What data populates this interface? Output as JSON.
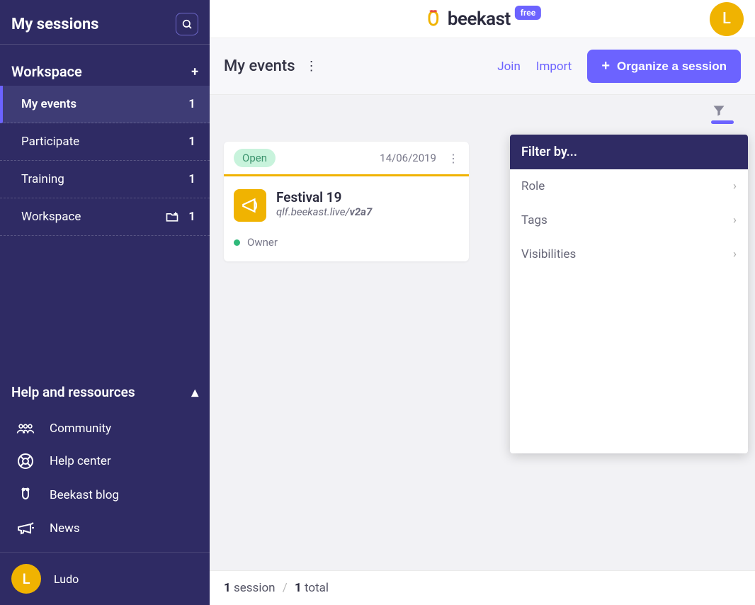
{
  "sidebar": {
    "title": "My sessions",
    "workspace_header": "Workspace",
    "items": [
      {
        "label": "My events",
        "count": "1",
        "active": true
      },
      {
        "label": "Participate",
        "count": "1"
      },
      {
        "label": "Training",
        "count": "1"
      },
      {
        "label": "Workspace",
        "count": "1",
        "icon": "folder-add"
      }
    ],
    "help_header": "Help and ressources",
    "help_items": [
      {
        "label": "Community",
        "icon": "people"
      },
      {
        "label": "Help center",
        "icon": "lifebuoy"
      },
      {
        "label": "Beekast blog",
        "icon": "bee"
      },
      {
        "label": "News",
        "icon": "megaphone"
      }
    ],
    "user": {
      "name": "Ludo",
      "initial": "L"
    }
  },
  "topbar": {
    "brand": "beekast",
    "badge": "free",
    "avatar_initial": "L"
  },
  "toolbar": {
    "title": "My events",
    "join": "Join",
    "import": "Import",
    "organize": "Organize a session"
  },
  "event": {
    "status": "Open",
    "date": "14/06/2019",
    "title": "Festival 19",
    "url_base": "qlf.beekast.live/",
    "url_slug": "v2a7",
    "role": "Owner"
  },
  "filter": {
    "header": "Filter by...",
    "options": [
      "Role",
      "Tags",
      "Visibilities"
    ]
  },
  "footer": {
    "count": "1",
    "count_label": " session",
    "total": "1",
    "total_label": " total"
  }
}
